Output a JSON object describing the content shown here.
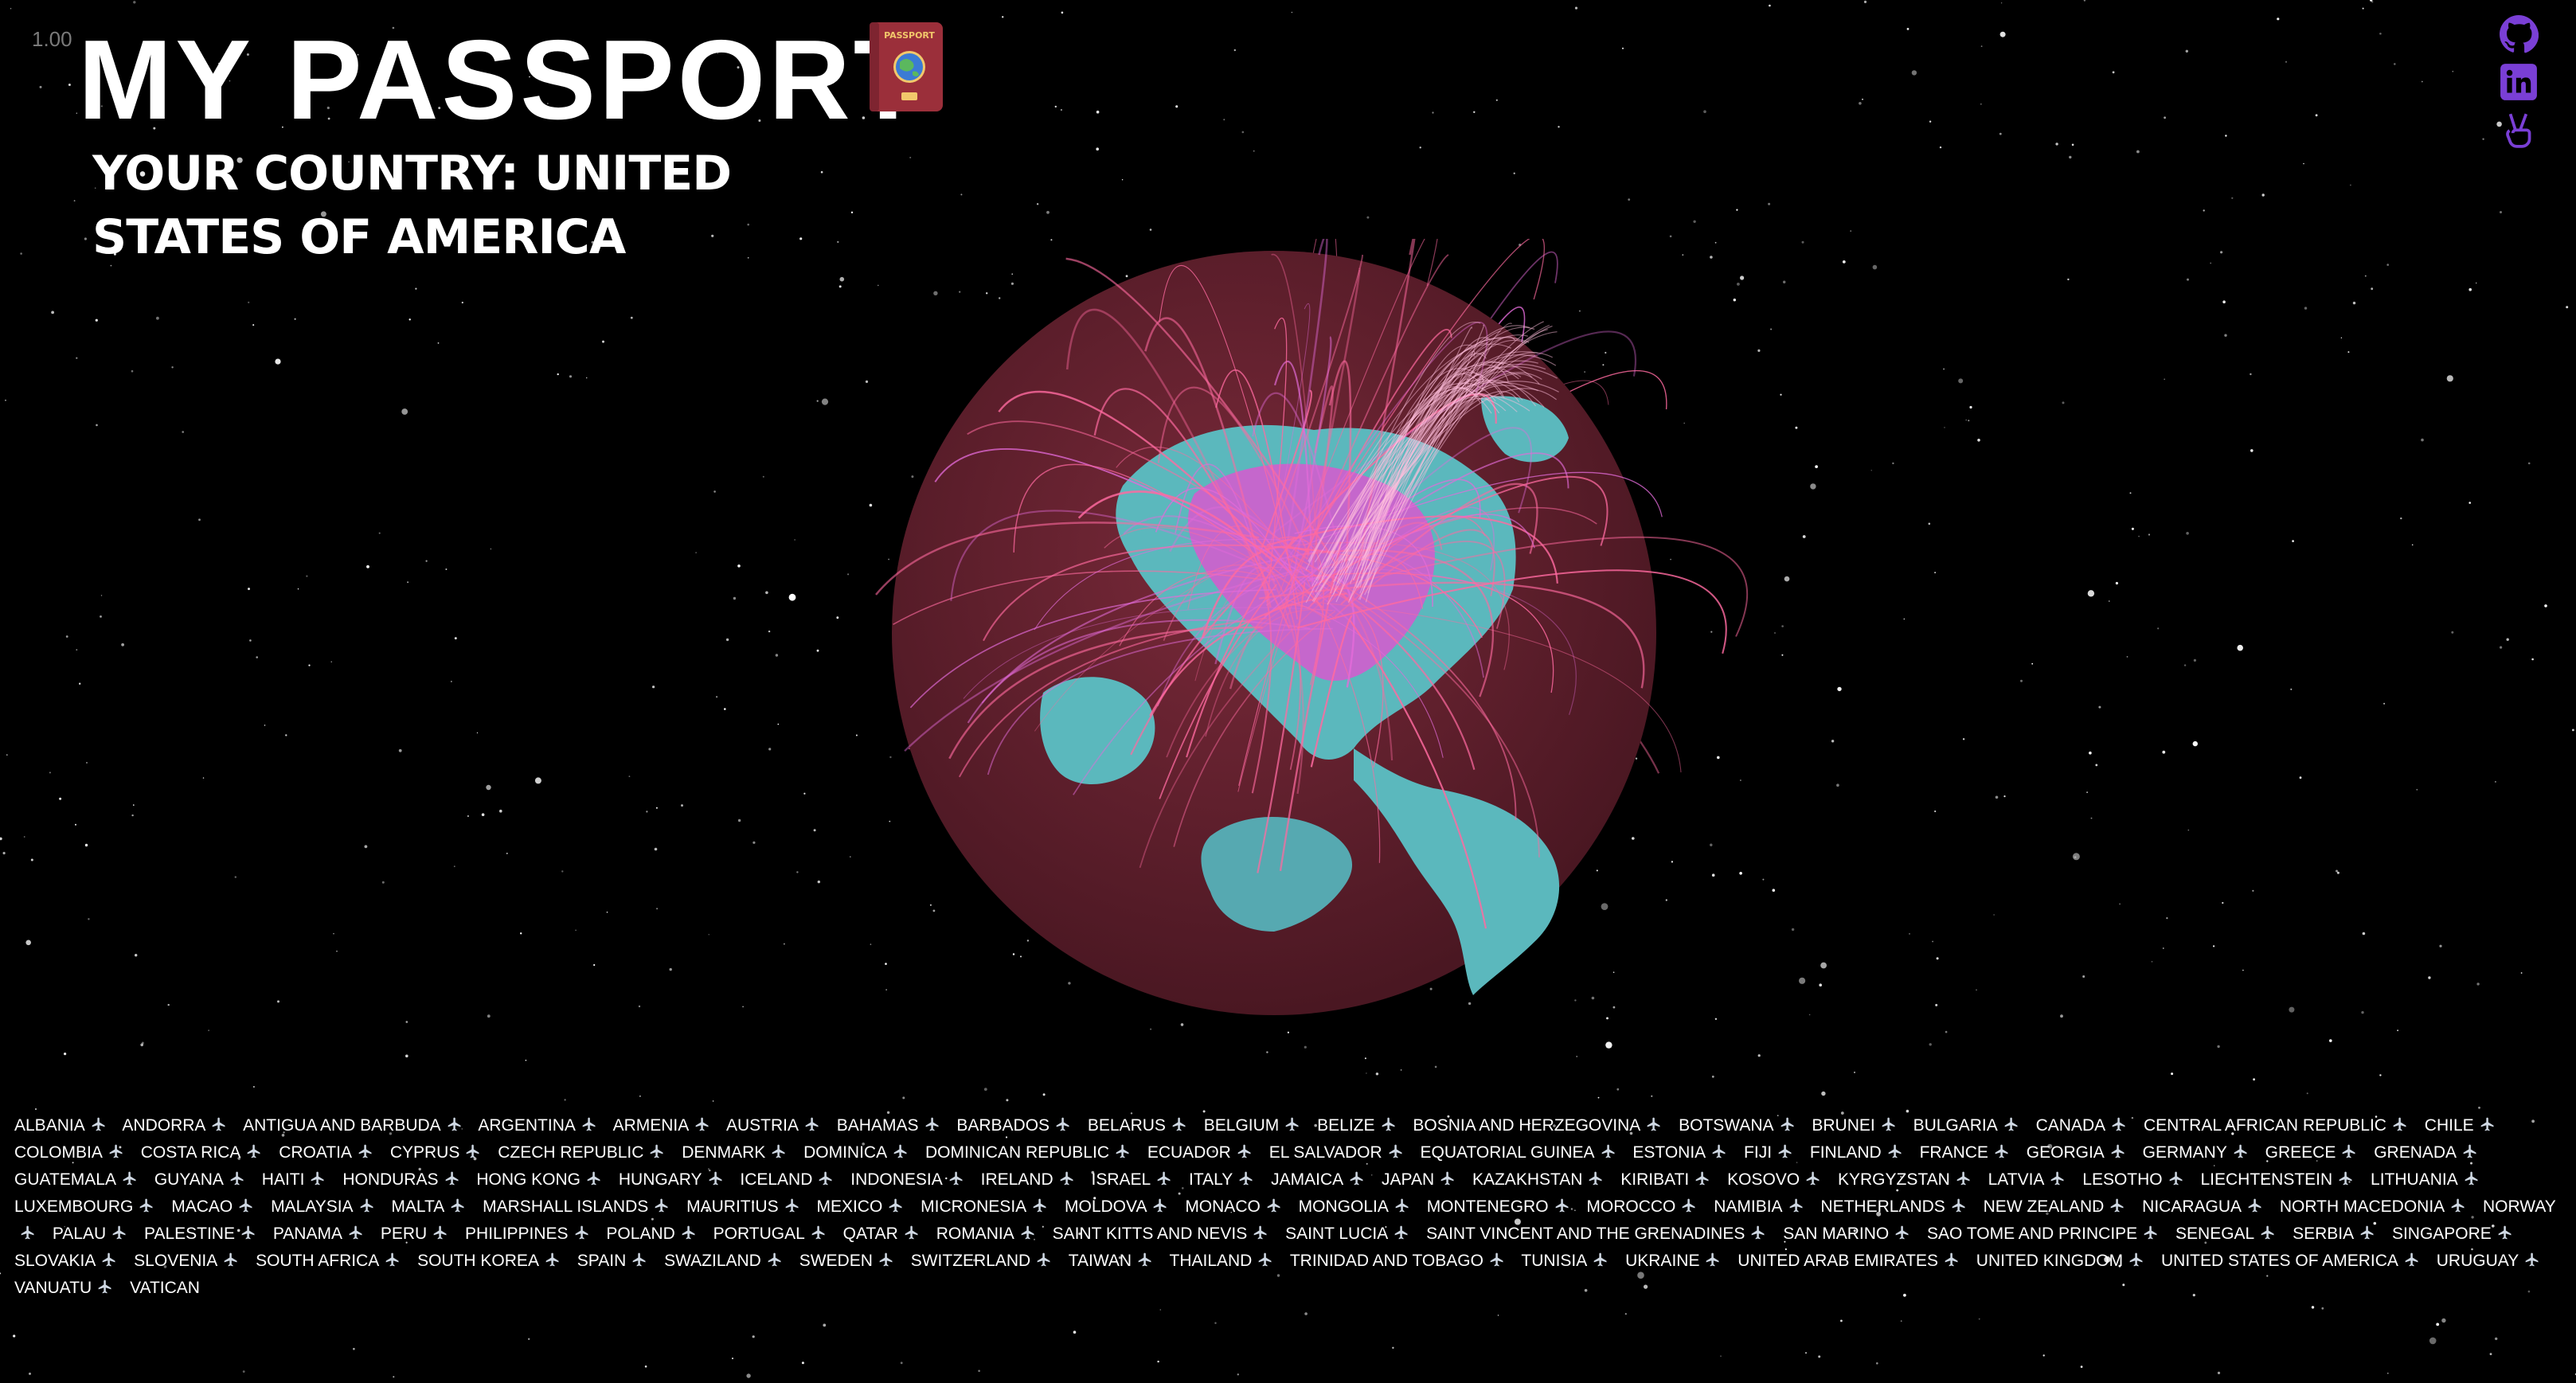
{
  "header": {
    "version": "1.00",
    "title": "MY PASSPORT",
    "subtitle": "YOUR COUNTRY: UNITED STATES OF AMERICA",
    "passport_icon": "passport-icon"
  },
  "social_links": [
    {
      "name": "github-icon",
      "color": "#7a3fd6"
    },
    {
      "name": "linkedin-icon",
      "color": "#7a3fd6"
    },
    {
      "name": "peace-hand-icon",
      "color": "#7a3fd6"
    }
  ],
  "globe": {
    "ocean_color": "#5c1f2d",
    "land_color": "#5bb8bd",
    "arc_color": "#ff6aa0",
    "highlight_color": "#e36bd9"
  },
  "separator_icon": "airplane-icon",
  "countries": [
    "ALBANIA",
    "ANDORRA",
    "ANTIGUA AND BARBUDA",
    "ARGENTINA",
    "ARMENIA",
    "AUSTRIA",
    "BAHAMAS",
    "BARBADOS",
    "BELARUS",
    "BELGIUM",
    "BELIZE",
    "BOSNIA AND HERZEGOVINA",
    "BOTSWANA",
    "BRUNEI",
    "BULGARIA",
    "CANADA",
    "CENTRAL AFRICAN REPUBLIC",
    "CHILE",
    "COLOMBIA",
    "COSTA RICA",
    "CROATIA",
    "CYPRUS",
    "CZECH REPUBLIC",
    "DENMARK",
    "DOMINICA",
    "DOMINICAN REPUBLIC",
    "ECUADOR",
    "EL SALVADOR",
    "EQUATORIAL GUINEA",
    "ESTONIA",
    "FIJI",
    "FINLAND",
    "FRANCE",
    "GEORGIA",
    "GERMANY",
    "GREECE",
    "GRENADA",
    "GUATEMALA",
    "GUYANA",
    "HAITI",
    "HONDURAS",
    "HONG KONG",
    "HUNGARY",
    "ICELAND",
    "INDONESIA",
    "IRELAND",
    "ISRAEL",
    "ITALY",
    "JAMAICA",
    "JAPAN",
    "KAZAKHSTAN",
    "KIRIBATI",
    "KOSOVO",
    "KYRGYZSTAN",
    "LATVIA",
    "LESOTHO",
    "LIECHTENSTEIN",
    "LITHUANIA",
    "LUXEMBOURG",
    "MACAO",
    "MALAYSIA",
    "MALTA",
    "MARSHALL ISLANDS",
    "MAURITIUS",
    "MEXICO",
    "MICRONESIA",
    "MOLDOVA",
    "MONACO",
    "MONGOLIA",
    "MONTENEGRO",
    "MOROCCO",
    "NAMIBIA",
    "NETHERLANDS",
    "NEW ZEALAND",
    "NICARAGUA",
    "NORTH MACEDONIA",
    "NORWAY",
    "PALAU",
    "PALESTINE",
    "PANAMA",
    "PERU",
    "PHILIPPINES",
    "POLAND",
    "PORTUGAL",
    "QATAR",
    "ROMANIA",
    "SAINT KITTS AND NEVIS",
    "SAINT LUCIA",
    "SAINT VINCENT AND THE GRENADINES",
    "SAN MARINO",
    "SAO TOME AND PRINCIPE",
    "SENEGAL",
    "SERBIA",
    "SINGAPORE",
    "SLOVAKIA",
    "SLOVENIA",
    "SOUTH AFRICA",
    "SOUTH KOREA",
    "SPAIN",
    "SWAZILAND",
    "SWEDEN",
    "SWITZERLAND",
    "TAIWAN",
    "THAILAND",
    "TRINIDAD AND TOBAGO",
    "TUNISIA",
    "UKRAINE",
    "UNITED ARAB EMIRATES",
    "UNITED KINGDOM",
    "UNITED STATES OF AMERICA",
    "URUGUAY",
    "VANUATU",
    "VATICAN"
  ]
}
